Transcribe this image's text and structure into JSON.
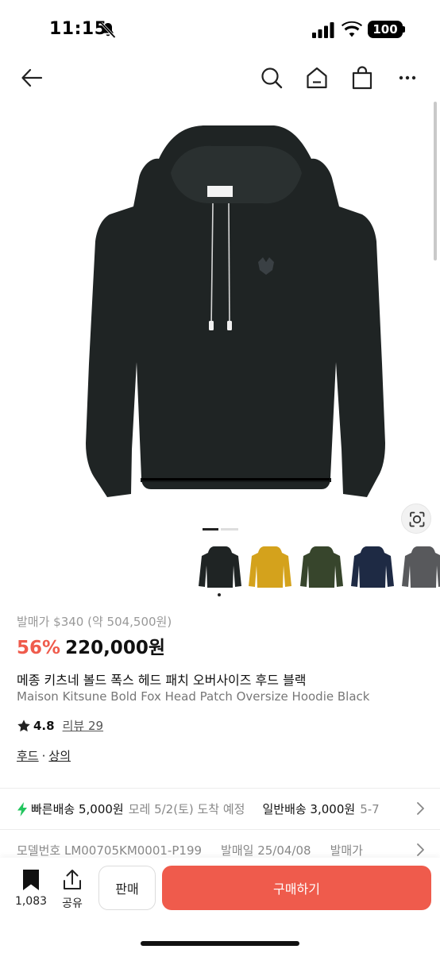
{
  "status": {
    "time": "11:15",
    "battery": "100"
  },
  "product": {
    "original_price": "발매가 $340 (약 504,500원)",
    "discount": "56%",
    "price": "220,000원",
    "title_ko": "메종 키츠네 볼드 폭스 헤드 패치 오버사이즈 후드 블랙",
    "title_en": "Maison Kitsune Bold Fox Head Patch Oversize Hoodie Black",
    "rating": "4.8",
    "reviews": "리뷰 29",
    "categories": [
      "후드",
      "상의"
    ],
    "category_sep": "·",
    "image_page": {
      "current": 1,
      "total": 2
    },
    "colors": [
      "#1f2424",
      "#d4a21c",
      "#37452c",
      "#1e2a44",
      "#58595c"
    ],
    "colors_selected_index": 0
  },
  "shipping": {
    "fast_label": "빠른배송 5,000원",
    "fast_eta": "모레 5/2(토) 도착 예정",
    "normal_label": "일반배송 3,000원",
    "normal_eta": "5-7"
  },
  "specs": {
    "model": "모델번호 LM00705KM0001-P199",
    "release": "발매일 25/04/08",
    "release_price": "발매가"
  },
  "bottom": {
    "bookmark_count": "1,083",
    "share_label": "공유",
    "sell_label": "판매",
    "buy_label": "구매하기"
  },
  "theme": {
    "accent": "#ef5b4c",
    "fast_icon": "#22c55e"
  }
}
